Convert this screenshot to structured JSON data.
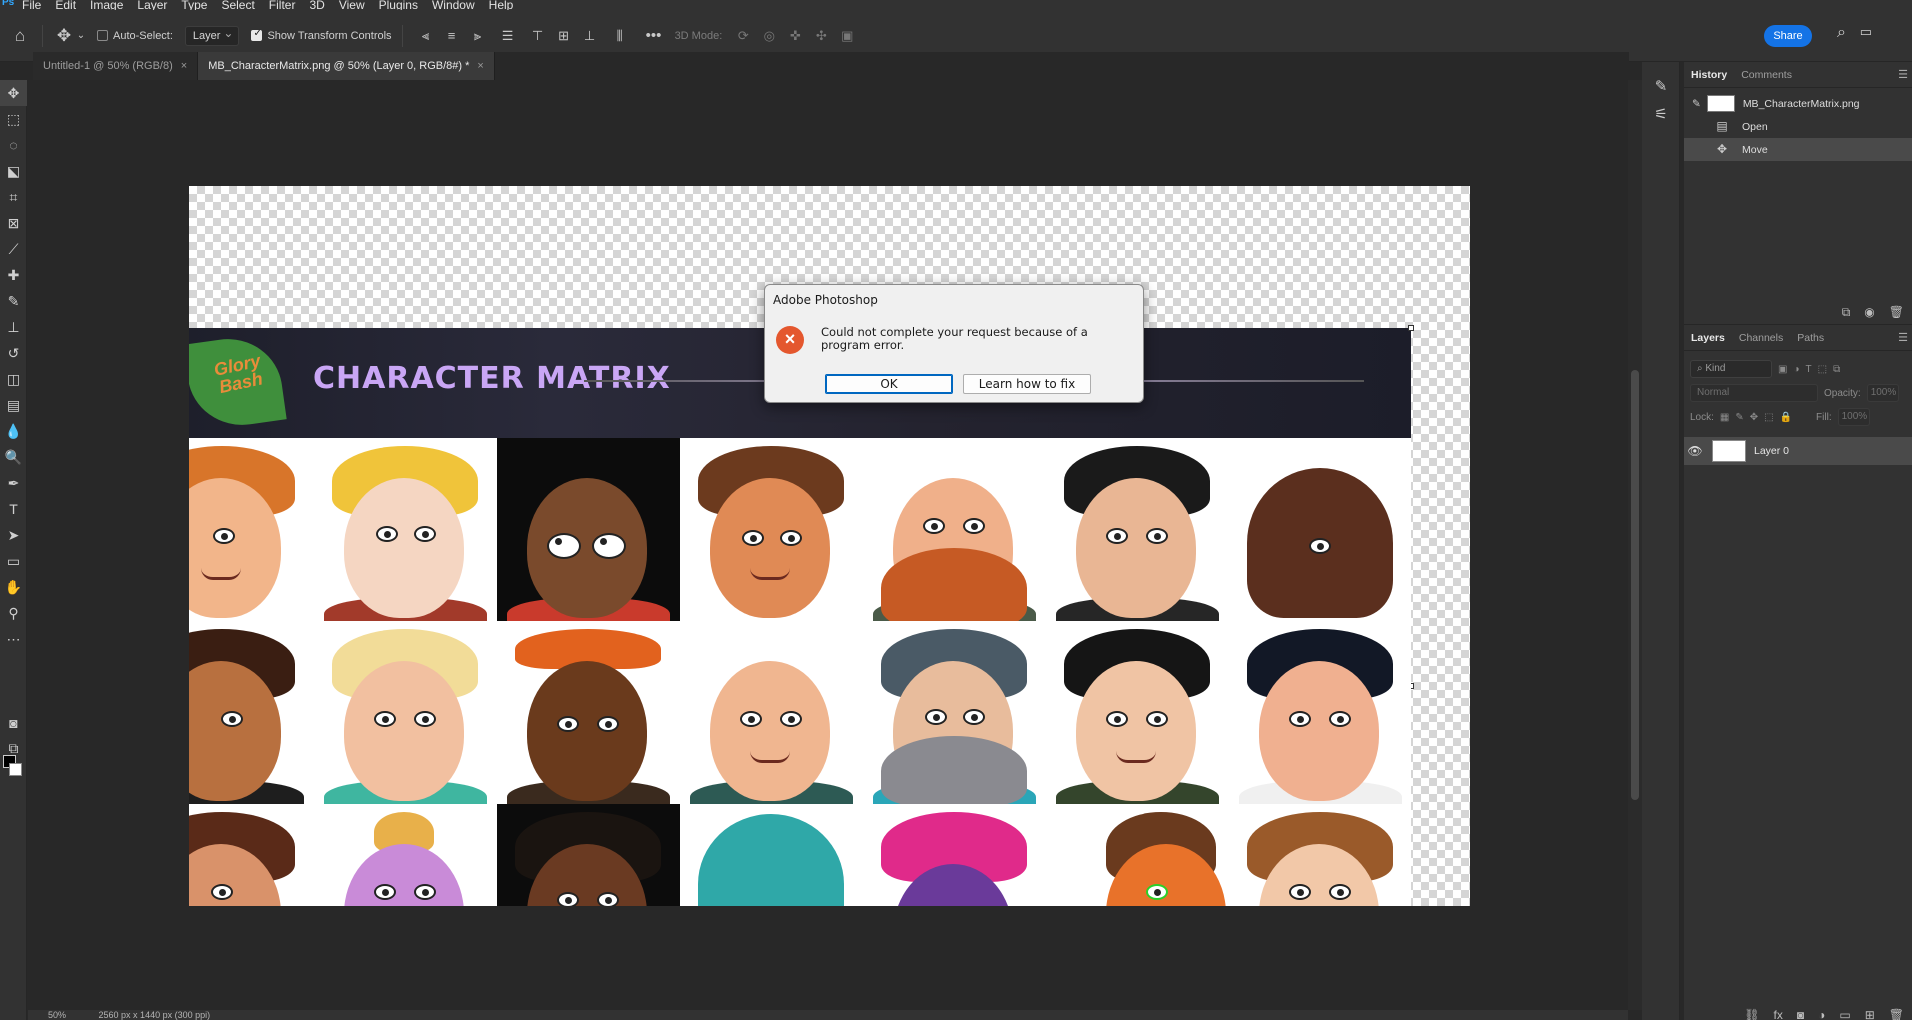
{
  "menu": [
    "File",
    "Edit",
    "Image",
    "Layer",
    "Type",
    "Select",
    "Filter",
    "3D",
    "View",
    "Plugins",
    "Window",
    "Help"
  ],
  "options": {
    "auto_select_label": "Auto-Select:",
    "auto_select_value": "Layer",
    "show_transform_label": "Show Transform Controls",
    "mode_3d_label": "3D Mode:",
    "share_label": "Share"
  },
  "tabs": [
    {
      "label": "Untitled-1 @ 50% (RGB/8)",
      "active": false
    },
    {
      "label": "MB_CharacterMatrix.png @ 50% (Layer 0, RGB/8#) *",
      "active": true
    }
  ],
  "canvas": {
    "banner_title": "CHARACTER MATRIX",
    "logo_text": "Glory Bash"
  },
  "dialog": {
    "title": "Adobe Photoshop",
    "message": "Could not complete your request because of a program error.",
    "ok_label": "OK",
    "learn_label": "Learn how to fix"
  },
  "statusbar": {
    "zoom": "50%",
    "doc_info": "2560 px x 1440 px (300 ppi)"
  },
  "history_panel": {
    "tabs": [
      "History",
      "Comments"
    ],
    "snapshot": "MB_CharacterMatrix.png",
    "states": [
      "Open",
      "Move"
    ]
  },
  "layers_panel": {
    "tabs": [
      "Layers",
      "Channels",
      "Paths"
    ],
    "kind_placeholder": "Kind",
    "blend_mode": "Normal",
    "opacity_label": "Opacity:",
    "opacity_value": "100%",
    "lock_label": "Lock:",
    "fill_label": "Fill:",
    "fill_value": "100%",
    "layer_name": "Layer 0"
  },
  "colors": {
    "accent": "#1473e6",
    "error": "#e4572e",
    "banner_title": "#c9a6f5"
  }
}
